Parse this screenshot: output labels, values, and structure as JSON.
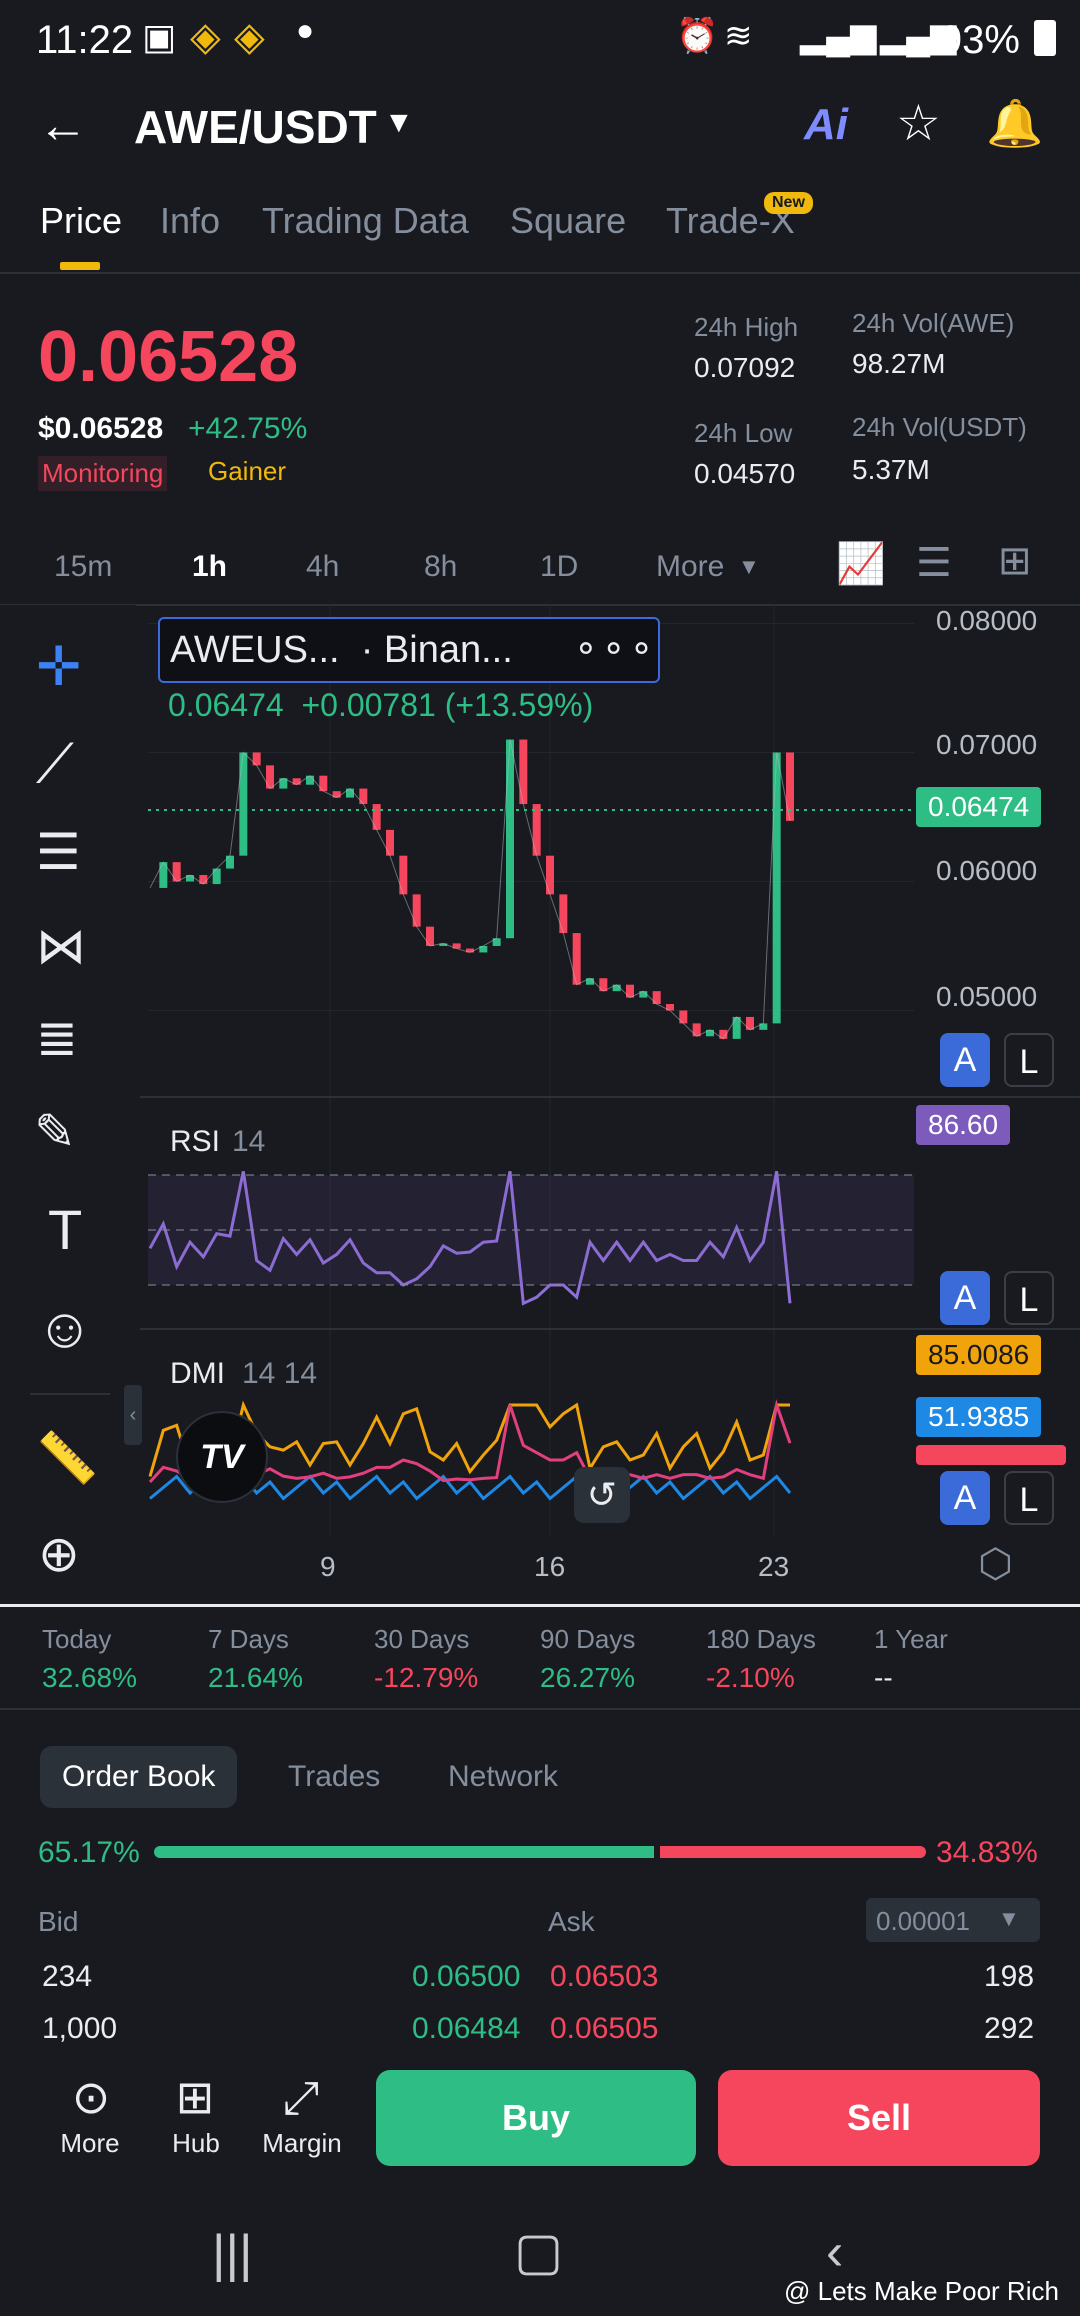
{
  "status": {
    "time": "11:22",
    "battery": "93%"
  },
  "header": {
    "pair": "AWE/USDT",
    "ai_label": "Ai"
  },
  "tabs": [
    {
      "label": "Price"
    },
    {
      "label": "Info"
    },
    {
      "label": "Trading Data"
    },
    {
      "label": "Square"
    },
    {
      "label": "Trade-X"
    }
  ],
  "new_badge": "New",
  "price": {
    "last": "0.06528",
    "usd": "$0.06528",
    "change": "+42.75%",
    "tag_monitoring": "Monitoring",
    "tag_gainer": "Gainer"
  },
  "stats": {
    "high_label": "24h High",
    "high": "0.07092",
    "low_label": "24h Low",
    "low": "0.04570",
    "vol_awe_label": "24h Vol(AWE)",
    "vol_awe": "98.27M",
    "vol_usdt_label": "24h Vol(USDT)",
    "vol_usdt": "5.37M"
  },
  "intervals": [
    "15m",
    "1h",
    "4h",
    "8h",
    "1D",
    "More"
  ],
  "chart": {
    "symbol_box": "AWEUS...  · Binan...",
    "ohlc_line": "0.06474  +0.00781 (+13.59%)",
    "current_price_tag": "0.06474",
    "rsi_label": "RSI",
    "rsi_param": "14",
    "rsi_tag": "86.60",
    "dmi_label": "DMI",
    "dmi_param": "14 14",
    "dmi_tag1": "85.0086",
    "dmi_tag2": "51.9385",
    "al_a": "A",
    "al_l": "L",
    "x_ticks": [
      "9",
      "16",
      "23"
    ],
    "tv_logo": "TV"
  },
  "chart_data": {
    "type": "line",
    "title": "",
    "y_ticks": [
      "0.08000",
      "0.07000",
      "0.06000",
      "0.05000"
    ],
    "ylim": [
      0.045,
      0.0805
    ],
    "x_ticks": [
      "9",
      "16",
      "23"
    ],
    "series": [
      {
        "values": [
          0.0595,
          0.0615,
          0.06,
          0.0605,
          0.0598,
          0.061,
          0.062,
          0.07,
          0.069,
          0.0672,
          0.068,
          0.0675,
          0.0682,
          0.067,
          0.0665,
          0.0672,
          0.066,
          0.064,
          0.062,
          0.059,
          0.0565,
          0.055,
          0.0552,
          0.0548,
          0.0545,
          0.055,
          0.0556,
          0.071,
          0.066,
          0.062,
          0.059,
          0.056,
          0.052,
          0.0525,
          0.0515,
          0.052,
          0.051,
          0.0515,
          0.0505,
          0.05,
          0.049,
          0.048,
          0.0485,
          0.0478,
          0.0495,
          0.0485,
          0.049,
          0.07,
          0.0647
        ]
      }
    ]
  },
  "performance": [
    {
      "label": "Today",
      "value": "32.68%",
      "color": "#2ebd85"
    },
    {
      "label": "7 Days",
      "value": "21.64%",
      "color": "#2ebd85"
    },
    {
      "label": "30 Days",
      "value": "-12.79%",
      "color": "#f6465d"
    },
    {
      "label": "90 Days",
      "value": "26.27%",
      "color": "#2ebd85"
    },
    {
      "label": "180 Days",
      "value": "-2.10%",
      "color": "#f6465d"
    },
    {
      "label": "1 Year",
      "value": "--",
      "color": "#eaecef"
    }
  ],
  "orderbook": {
    "tabs": [
      "Order Book",
      "Trades",
      "Network"
    ],
    "bid_pct": "65.17%",
    "ask_pct": "34.83%",
    "bid_ratio": 0.6517,
    "bid_label": "Bid",
    "ask_label": "Ask",
    "precision": "0.00001",
    "rows": [
      {
        "bid_qty": "234",
        "bid_price": "0.06500",
        "ask_price": "0.06503",
        "ask_qty": "198"
      },
      {
        "bid_qty": "1,000",
        "bid_price": "0.06484",
        "ask_price": "0.06505",
        "ask_qty": "292"
      }
    ]
  },
  "actions": {
    "more": "More",
    "hub": "Hub",
    "margin": "Margin",
    "buy": "Buy",
    "sell": "Sell"
  },
  "watermark": "@ Lets Make Poor Rich",
  "colors": {
    "green": "#2ebd85",
    "red": "#f6465d",
    "yellow": "#f0b90b",
    "purple": "#7d5bbd",
    "blue": "#1e88e5"
  }
}
